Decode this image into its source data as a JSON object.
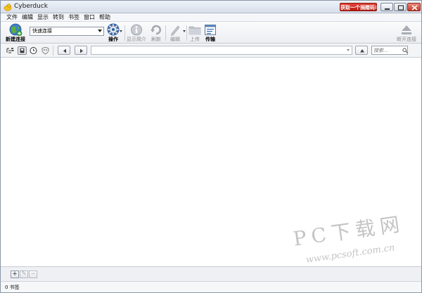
{
  "window": {
    "title": "Cyberduck",
    "promo_label": "获取一个捐赠码!"
  },
  "menu": [
    "文件",
    "编辑",
    "显示",
    "转到",
    "书签",
    "窗口",
    "帮助"
  ],
  "toolbar": {
    "new_connection": "新建连接",
    "quick_connect_value": "快速连接",
    "action": "操作",
    "get_info": "显示简介",
    "refresh": "刷新",
    "edit": "编辑",
    "upload": "上传",
    "transfers": "传输",
    "disconnect": "断开连接"
  },
  "nav": {
    "path_value": "",
    "search_placeholder": "搜索..."
  },
  "watermark": {
    "main": "PC下载网",
    "url": "www.pcsoft.com.cn"
  },
  "bottom": {
    "add": "+",
    "edit": "✎",
    "remove": "−"
  },
  "status": {
    "text": "0 书签"
  },
  "colors": {
    "promo": "#c4281d",
    "accent": "#2f6db5"
  }
}
